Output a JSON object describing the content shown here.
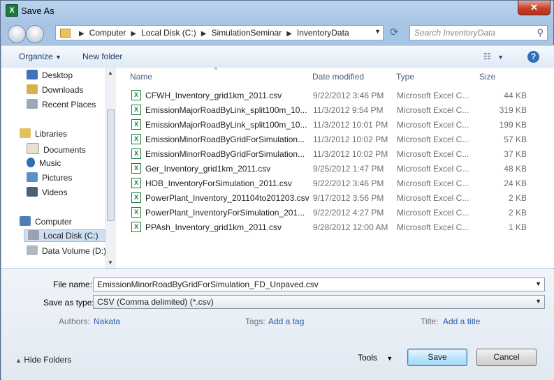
{
  "window": {
    "title": "Save As",
    "close_label": "✕",
    "app_icon": "excel-icon"
  },
  "address": {
    "crumbs": [
      "Computer",
      "Local Disk (C:)",
      "SimulationSeminar",
      "InventoryData"
    ]
  },
  "search": {
    "placeholder": "Search InventoryData"
  },
  "toolbar": {
    "organize": "Organize",
    "new_folder": "New folder",
    "help": "?"
  },
  "nav": {
    "favorites": [
      {
        "label": "Desktop",
        "icon": "desktop-icon"
      },
      {
        "label": "Downloads",
        "icon": "downloads-icon"
      },
      {
        "label": "Recent Places",
        "icon": "recent-places-icon"
      }
    ],
    "libraries_label": "Libraries",
    "libraries": [
      {
        "label": "Documents",
        "icon": "documents-icon"
      },
      {
        "label": "Music",
        "icon": "music-icon"
      },
      {
        "label": "Pictures",
        "icon": "pictures-icon"
      },
      {
        "label": "Videos",
        "icon": "videos-icon"
      }
    ],
    "computer_label": "Computer",
    "drives": [
      {
        "label": "Local Disk (C:)",
        "icon": "drive-icon",
        "selected": true
      },
      {
        "label": "Data Volume (D:)",
        "icon": "drive-icon",
        "selected": false
      }
    ]
  },
  "columns": {
    "name": "Name",
    "date": "Date modified",
    "type": "Type",
    "size": "Size"
  },
  "files": [
    {
      "name": "CFWH_Inventory_grid1km_2011.csv",
      "date": "9/22/2012 3:46 PM",
      "type": "Microsoft Excel C...",
      "size": "44 KB"
    },
    {
      "name": "EmissionMajorRoadByLink_split100m_10...",
      "date": "11/3/2012 9:54 PM",
      "type": "Microsoft Excel C...",
      "size": "319 KB"
    },
    {
      "name": "EmissionMajorRoadByLink_split100m_10...",
      "date": "11/3/2012 10:01 PM",
      "type": "Microsoft Excel C...",
      "size": "199 KB"
    },
    {
      "name": "EmissionMinorRoadByGridForSimulation...",
      "date": "11/3/2012 10:02 PM",
      "type": "Microsoft Excel C...",
      "size": "57 KB"
    },
    {
      "name": "EmissionMinorRoadByGridForSimulation...",
      "date": "11/3/2012 10:02 PM",
      "type": "Microsoft Excel C...",
      "size": "37 KB"
    },
    {
      "name": "Ger_Inventory_grid1km_2011.csv",
      "date": "9/25/2012 1:47 PM",
      "type": "Microsoft Excel C...",
      "size": "48 KB"
    },
    {
      "name": "HOB_InventoryForSimulation_2011.csv",
      "date": "9/22/2012 3:46 PM",
      "type": "Microsoft Excel C...",
      "size": "24 KB"
    },
    {
      "name": "PowerPlant_Inventory_201104to201203.csv",
      "date": "9/17/2012 3:56 PM",
      "type": "Microsoft Excel C...",
      "size": "2 KB"
    },
    {
      "name": "PowerPlant_InventoryForSimulation_201...",
      "date": "9/22/2012 4:27 PM",
      "type": "Microsoft Excel C...",
      "size": "2 KB"
    },
    {
      "name": "PPAsh_Inventory_grid1km_2011.csv",
      "date": "9/28/2012 12:00 AM",
      "type": "Microsoft Excel C...",
      "size": "1 KB"
    }
  ],
  "form": {
    "filename_label": "File name:",
    "filename_value": "EmissionMinorRoadByGridForSimulation_FD_Unpaved.csv",
    "type_label": "Save as type:",
    "type_value": "CSV (Comma delimited) (*.csv)",
    "authors_label": "Authors:",
    "authors_value": "Nakata",
    "tags_label": "Tags:",
    "tags_value": "Add a tag",
    "title_label": "Title:",
    "title_value": "Add a title"
  },
  "footer": {
    "hide_folders": "Hide Folders",
    "tools": "Tools",
    "save": "Save",
    "cancel": "Cancel"
  },
  "colors": {
    "accent": "#2f6fbd",
    "excel": "#1d7a3c",
    "frame": "#a9c5e6"
  }
}
